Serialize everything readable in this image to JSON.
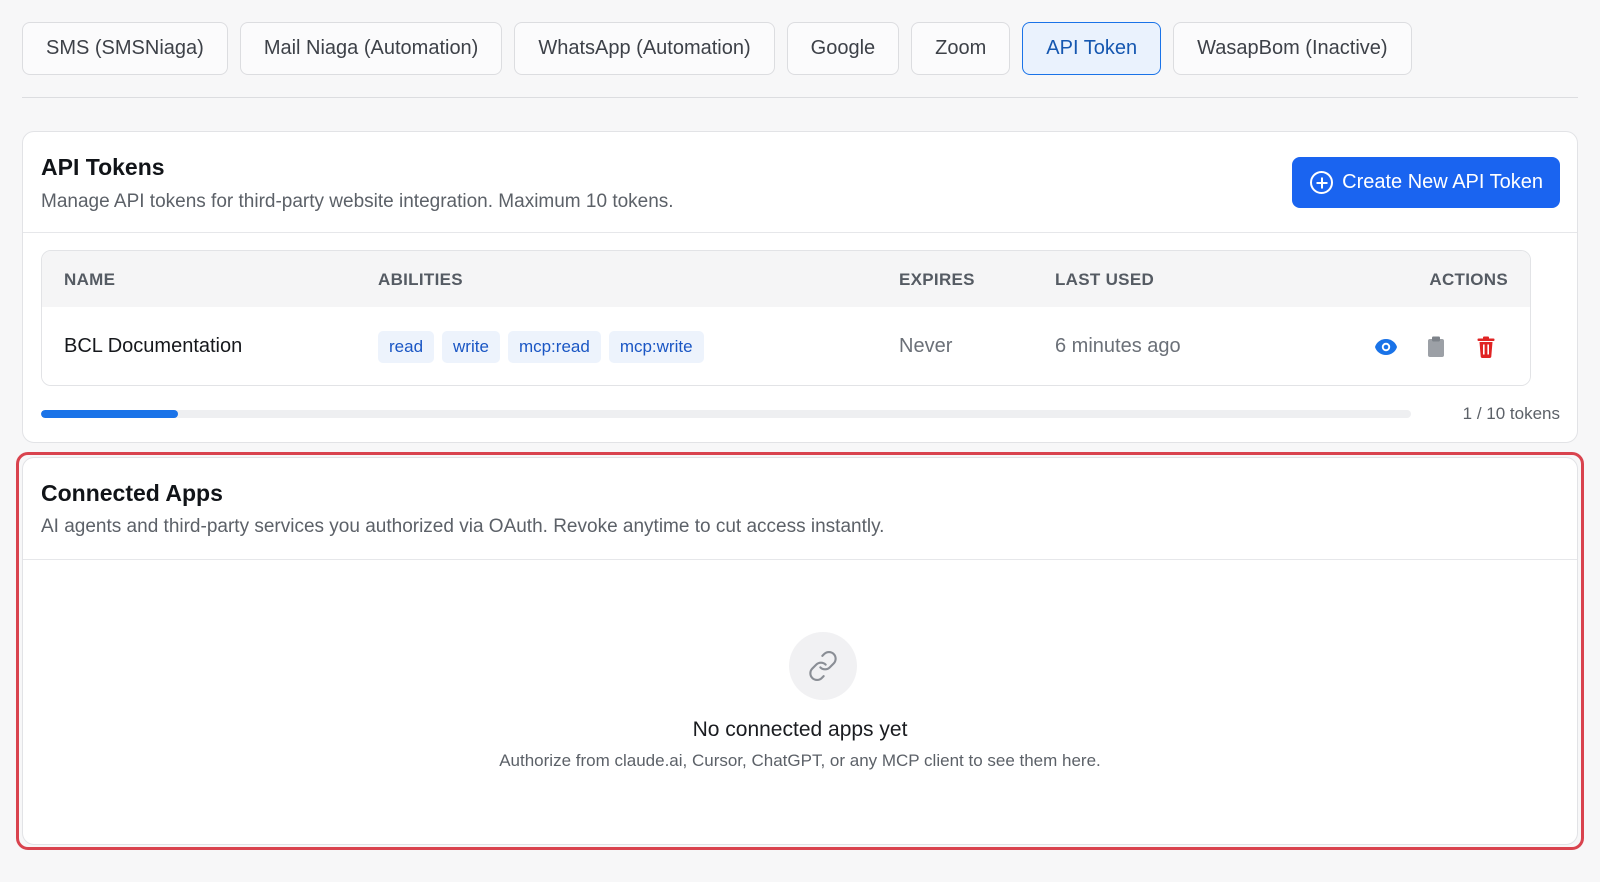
{
  "tabs": [
    {
      "label": "SMS (SMSNiaga)",
      "active": false
    },
    {
      "label": "Mail Niaga (Automation)",
      "active": false
    },
    {
      "label": "WhatsApp (Automation)",
      "active": false
    },
    {
      "label": "Google",
      "active": false
    },
    {
      "label": "Zoom",
      "active": false
    },
    {
      "label": "API Token",
      "active": true
    },
    {
      "label": "WasapBom (Inactive)",
      "active": false
    }
  ],
  "api_tokens": {
    "title": "API Tokens",
    "description": "Manage API tokens for third-party website integration. Maximum 10 tokens.",
    "create_button_label": "Create New API Token",
    "columns": {
      "name": "NAME",
      "abilities": "ABILITIES",
      "expires": "EXPIRES",
      "last_used": "LAST USED",
      "actions": "ACTIONS"
    },
    "rows": [
      {
        "name": "BCL Documentation",
        "abilities": [
          "read",
          "write",
          "mcp:read",
          "mcp:write"
        ],
        "expires": "Never",
        "last_used": "6 minutes ago",
        "actions": [
          "eye-icon",
          "clipboard-icon",
          "trash-icon"
        ]
      }
    ],
    "usage": {
      "used": 1,
      "max": 10,
      "label": "1 / 10 tokens"
    }
  },
  "connected_apps": {
    "title": "Connected Apps",
    "description": "AI agents and third-party services you authorized via OAuth. Revoke anytime to cut access instantly.",
    "empty_icon": "link-icon",
    "empty_title": "No connected apps yet",
    "empty_subtitle": "Authorize from claude.ai, Cursor, ChatGPT, or any MCP client to see them here."
  },
  "colors": {
    "accent": "#1a64f0",
    "active_tab_bg": "#eaf2fd",
    "highlight_border": "#d9434e",
    "delete": "#e02424",
    "view": "#1a73e8",
    "copy": "#9ca0a6"
  }
}
